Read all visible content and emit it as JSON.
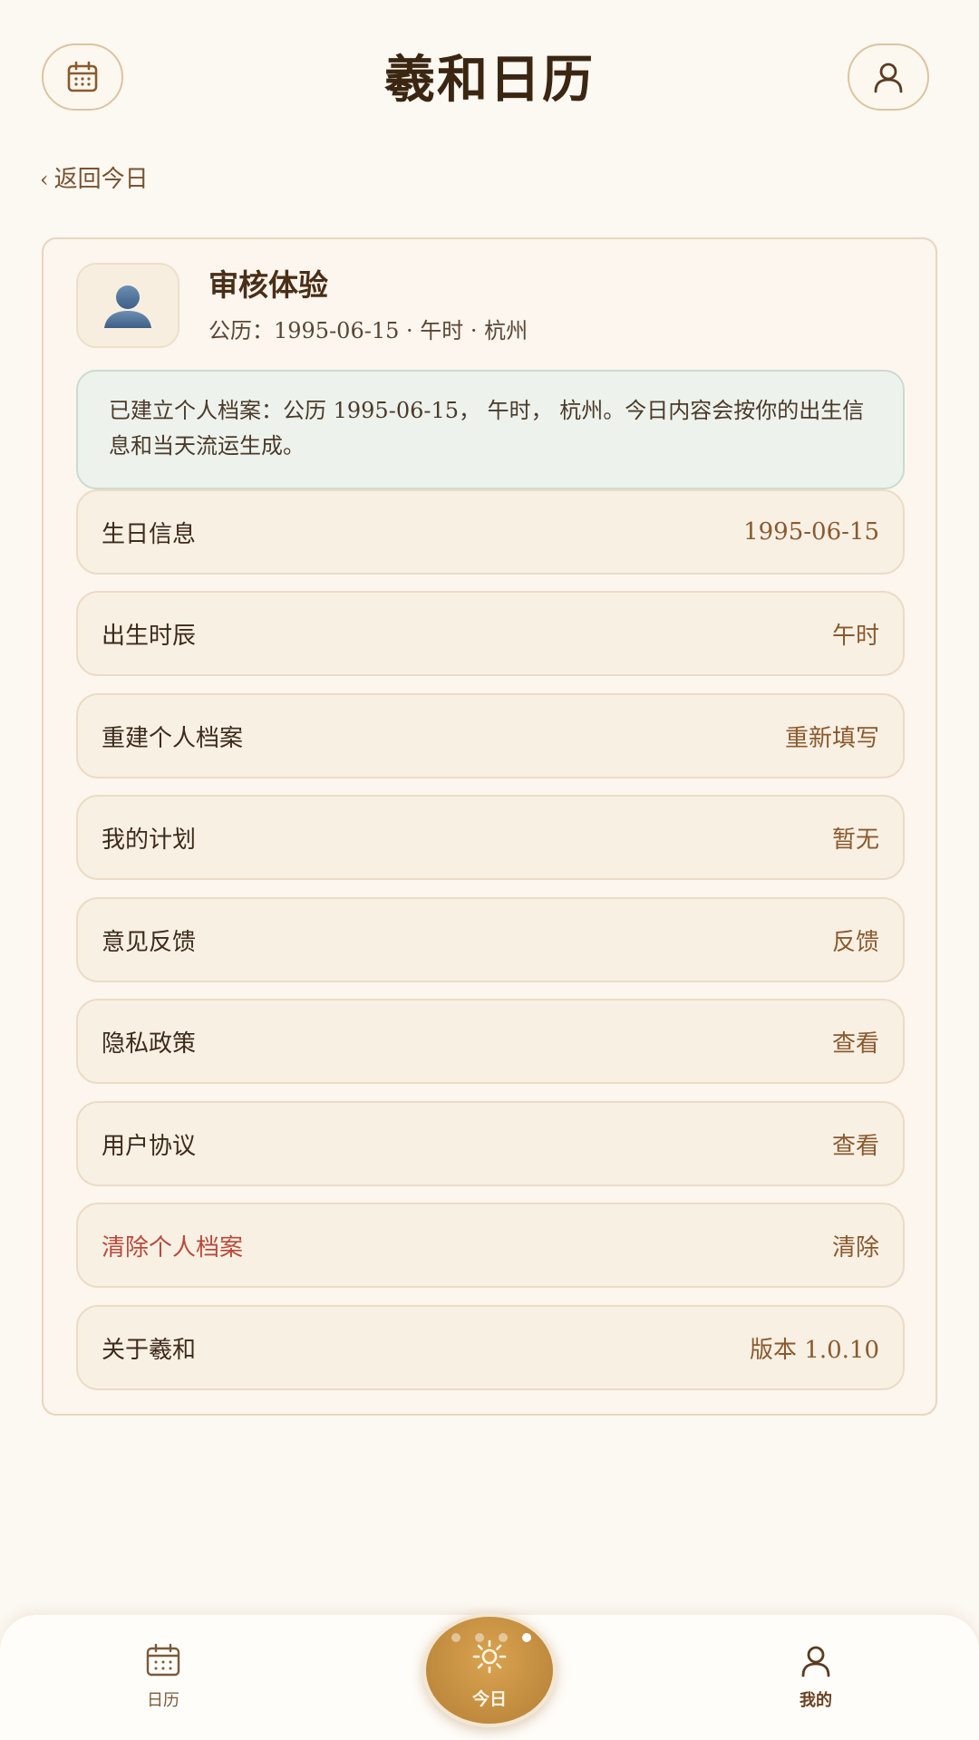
{
  "header": {
    "title": "羲和日历",
    "calendar_icon": "calendar-icon",
    "user_icon": "user-icon"
  },
  "back_link": {
    "chevron": "‹",
    "label": "返回今日"
  },
  "profile": {
    "name": "审核体验",
    "subtitle": "公历：1995-06-15 · 午时 · 杭州",
    "avatar_icon": "person-avatar-icon"
  },
  "notice": "已建立个人档案：公历 1995-06-15， 午时， 杭州。今日内容会按你的出生信息和当天流运生成。",
  "rows": [
    {
      "label": "生日信息",
      "value": "1995-06-15",
      "danger": false
    },
    {
      "label": "出生时辰",
      "value": "午时",
      "danger": false
    },
    {
      "label": "重建个人档案",
      "value": "重新填写",
      "danger": false
    },
    {
      "label": "我的计划",
      "value": "暂无",
      "danger": false
    },
    {
      "label": "意见反馈",
      "value": "反馈",
      "danger": false
    },
    {
      "label": "隐私政策",
      "value": "查看",
      "danger": false
    },
    {
      "label": "用户协议",
      "value": "查看",
      "danger": false
    },
    {
      "label": "清除个人档案",
      "value": "清除",
      "danger": true
    },
    {
      "label": "关于羲和",
      "value": "版本 1.0.10",
      "danger": false
    }
  ],
  "bottom_nav": {
    "calendar": "日历",
    "today": "今日",
    "mine": "我的",
    "page_dots": 4,
    "active_page_dot": 4
  },
  "colors": {
    "background": "#fcf8f2",
    "accent_gold": "#c08a3e",
    "danger": "#b84a3a",
    "notice_bg": "#eef2ec"
  }
}
